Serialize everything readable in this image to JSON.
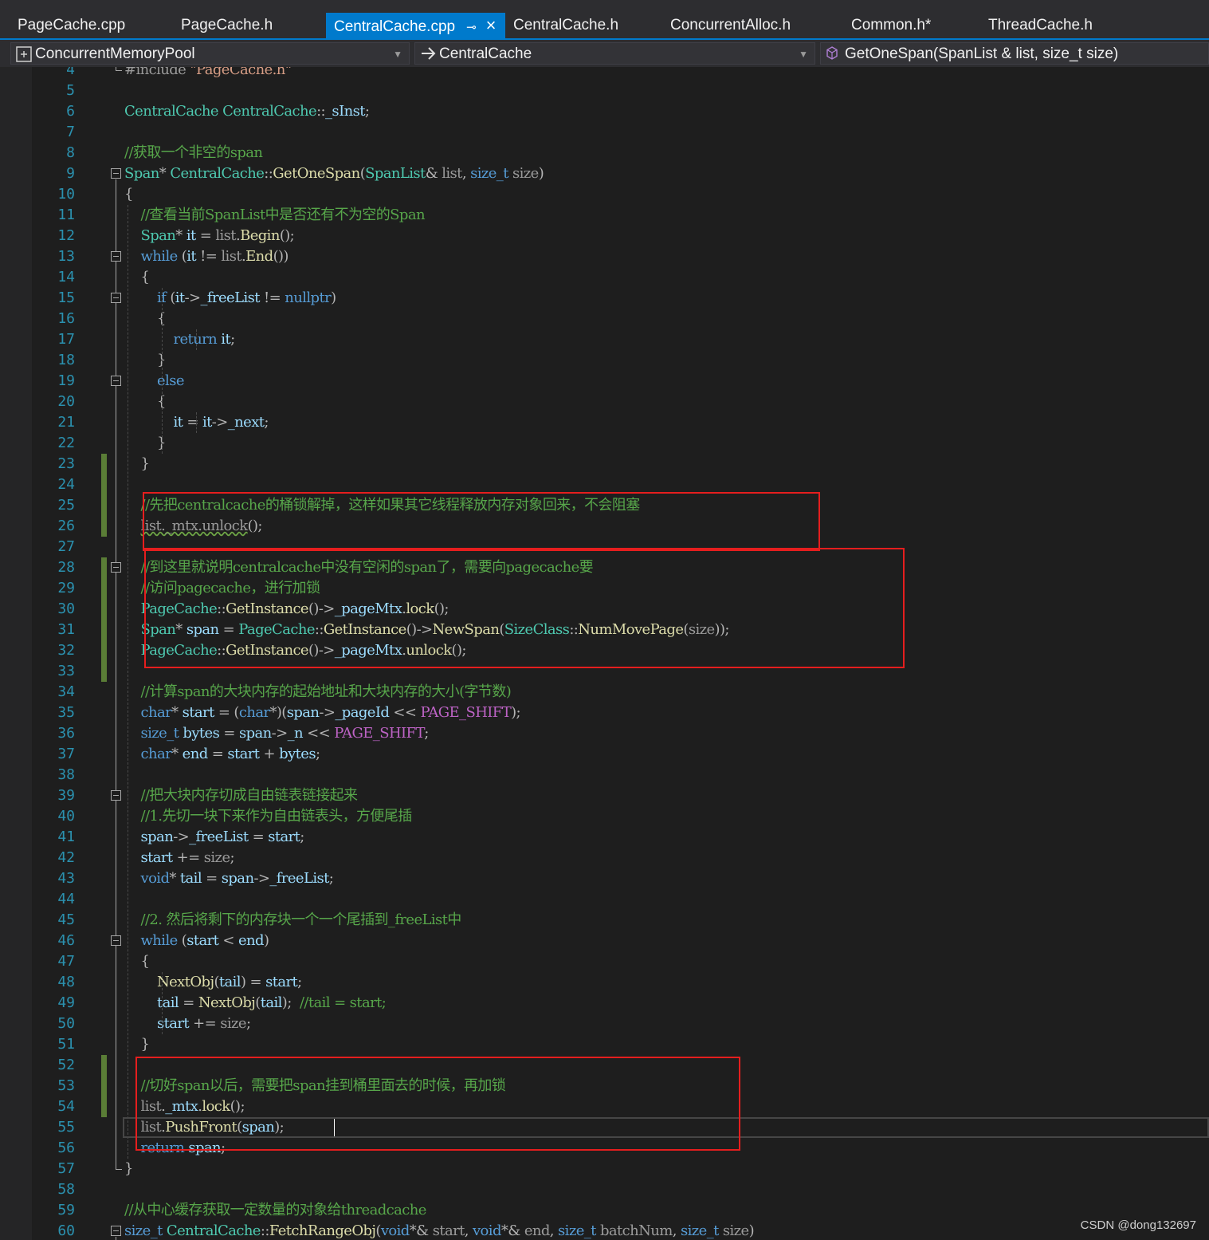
{
  "tabs": [
    {
      "label": "PageCache.cpp",
      "active": false
    },
    {
      "label": "PageCache.h",
      "active": false
    },
    {
      "label": "CentralCache.cpp",
      "active": true
    },
    {
      "label": "CentralCache.h",
      "active": false
    },
    {
      "label": "ConcurrentAlloc.h",
      "active": false
    },
    {
      "label": "Common.h*",
      "active": false
    },
    {
      "label": "ThreadCache.h",
      "active": false
    }
  ],
  "tab_icons": {
    "pin": "pin-icon",
    "close": "close-icon"
  },
  "navbar": {
    "project": "ConcurrentMemoryPool",
    "scope": "CentralCache",
    "member": "GetOneSpan(SpanList & list, size_t size)",
    "project_icon": "project-icon",
    "scope_icon": "arrow-right-icon",
    "member_icon": "method-cube-icon",
    "dropdown_icon": "chevron-down-icon"
  },
  "editor": {
    "first_line": 4,
    "caret_line": 55,
    "lines": [
      [
        [
          "pp",
          "#include "
        ],
        [
          "s",
          "\"PageCache.h\""
        ]
      ],
      [],
      [
        [
          "t",
          "CentralCache"
        ],
        [
          "x",
          " "
        ],
        [
          "t",
          "CentralCache"
        ],
        [
          "p",
          "::"
        ],
        [
          "v",
          "_sInst"
        ],
        [
          "p",
          ";"
        ]
      ],
      [],
      [
        [
          "c",
          "//获取一个非空的span"
        ]
      ],
      [
        [
          "t",
          "Span"
        ],
        [
          "p",
          "* "
        ],
        [
          "t",
          "CentralCache"
        ],
        [
          "p",
          "::"
        ],
        [
          "f",
          "GetOneSpan"
        ],
        [
          "p",
          "("
        ],
        [
          "t",
          "SpanList"
        ],
        [
          "p",
          "& "
        ],
        [
          "pp",
          "list"
        ],
        [
          "p",
          ", "
        ],
        [
          "k",
          "size_t"
        ],
        [
          "x",
          " "
        ],
        [
          "pp",
          "size"
        ],
        [
          "p",
          ")"
        ]
      ],
      [
        [
          "p",
          "{"
        ]
      ],
      [
        [
          "x",
          "    "
        ],
        [
          "c",
          "//查看当前SpanList中是否还有不为空的Span"
        ]
      ],
      [
        [
          "x",
          "    "
        ],
        [
          "t",
          "Span"
        ],
        [
          "p",
          "* "
        ],
        [
          "v",
          "it"
        ],
        [
          "p",
          " = "
        ],
        [
          "pp",
          "list"
        ],
        [
          "p",
          "."
        ],
        [
          "f",
          "Begin"
        ],
        [
          "p",
          "();"
        ]
      ],
      [
        [
          "x",
          "    "
        ],
        [
          "k",
          "while"
        ],
        [
          "p",
          " ("
        ],
        [
          "v",
          "it"
        ],
        [
          "p",
          " != "
        ],
        [
          "pp",
          "list"
        ],
        [
          "p",
          "."
        ],
        [
          "f",
          "End"
        ],
        [
          "p",
          "())"
        ]
      ],
      [
        [
          "x",
          "    "
        ],
        [
          "p",
          "{"
        ]
      ],
      [
        [
          "x",
          "        "
        ],
        [
          "k",
          "if"
        ],
        [
          "p",
          " ("
        ],
        [
          "v",
          "it"
        ],
        [
          "p",
          "->"
        ],
        [
          "v",
          "_freeList"
        ],
        [
          "p",
          " != "
        ],
        [
          "k",
          "nullptr"
        ],
        [
          "p",
          ")"
        ]
      ],
      [
        [
          "x",
          "        "
        ],
        [
          "p",
          "{"
        ]
      ],
      [
        [
          "x",
          "            "
        ],
        [
          "k",
          "return"
        ],
        [
          "x",
          " "
        ],
        [
          "v",
          "it"
        ],
        [
          "p",
          ";"
        ]
      ],
      [
        [
          "x",
          "        "
        ],
        [
          "p",
          "}"
        ]
      ],
      [
        [
          "x",
          "        "
        ],
        [
          "k",
          "else"
        ]
      ],
      [
        [
          "x",
          "        "
        ],
        [
          "p",
          "{"
        ]
      ],
      [
        [
          "x",
          "            "
        ],
        [
          "v",
          "it"
        ],
        [
          "p",
          " = "
        ],
        [
          "v",
          "it"
        ],
        [
          "p",
          "->"
        ],
        [
          "v",
          "_next"
        ],
        [
          "p",
          ";"
        ]
      ],
      [
        [
          "x",
          "        "
        ],
        [
          "p",
          "}"
        ]
      ],
      [
        [
          "x",
          "    "
        ],
        [
          "p",
          "}"
        ]
      ],
      [],
      [
        [
          "x",
          "    "
        ],
        [
          "c",
          "//先把centralcache的桶锁解掉，这样如果其它线程释放内存对象回来，不会阻塞"
        ]
      ],
      [
        [
          "x",
          "    "
        ],
        [
          "sq",
          "list._mtx.unlock"
        ],
        [
          "p",
          "();"
        ]
      ],
      [],
      [
        [
          "x",
          "    "
        ],
        [
          "c",
          "//到这里就说明centralcache中没有空闲的span了，需要向pagecache要"
        ]
      ],
      [
        [
          "x",
          "    "
        ],
        [
          "c",
          "//访问pagecache，进行加锁"
        ]
      ],
      [
        [
          "x",
          "    "
        ],
        [
          "t",
          "PageCache"
        ],
        [
          "p",
          "::"
        ],
        [
          "f",
          "GetInstance"
        ],
        [
          "p",
          "()->"
        ],
        [
          "v",
          "_pageMtx"
        ],
        [
          "p",
          "."
        ],
        [
          "f",
          "lock"
        ],
        [
          "p",
          "();"
        ]
      ],
      [
        [
          "x",
          "    "
        ],
        [
          "t",
          "Span"
        ],
        [
          "p",
          "* "
        ],
        [
          "v",
          "span"
        ],
        [
          "p",
          " = "
        ],
        [
          "t",
          "PageCache"
        ],
        [
          "p",
          "::"
        ],
        [
          "f",
          "GetInstance"
        ],
        [
          "p",
          "()->"
        ],
        [
          "f",
          "NewSpan"
        ],
        [
          "p",
          "("
        ],
        [
          "t",
          "SizeClass"
        ],
        [
          "p",
          "::"
        ],
        [
          "f",
          "NumMovePage"
        ],
        [
          "p",
          "("
        ],
        [
          "pp",
          "size"
        ],
        [
          "p",
          "));"
        ]
      ],
      [
        [
          "x",
          "    "
        ],
        [
          "t",
          "PageCache"
        ],
        [
          "p",
          "::"
        ],
        [
          "f",
          "GetInstance"
        ],
        [
          "p",
          "()->"
        ],
        [
          "v",
          "_pageMtx"
        ],
        [
          "p",
          "."
        ],
        [
          "f",
          "unlock"
        ],
        [
          "p",
          "();"
        ]
      ],
      [],
      [
        [
          "x",
          "    "
        ],
        [
          "c",
          "//计算span的大块内存的起始地址和大块内存的大小(字节数)"
        ]
      ],
      [
        [
          "x",
          "    "
        ],
        [
          "k",
          "char"
        ],
        [
          "p",
          "* "
        ],
        [
          "v",
          "start"
        ],
        [
          "p",
          " = ("
        ],
        [
          "k",
          "char"
        ],
        [
          "p",
          "*)("
        ],
        [
          "v",
          "span"
        ],
        [
          "p",
          "->"
        ],
        [
          "v",
          "_pageId"
        ],
        [
          "p",
          " << "
        ],
        [
          "mac",
          "PAGE_SHIFT"
        ],
        [
          "p",
          ");"
        ]
      ],
      [
        [
          "x",
          "    "
        ],
        [
          "k",
          "size_t"
        ],
        [
          "x",
          " "
        ],
        [
          "v",
          "bytes"
        ],
        [
          "p",
          " = "
        ],
        [
          "v",
          "span"
        ],
        [
          "p",
          "->"
        ],
        [
          "v",
          "_n"
        ],
        [
          "p",
          " << "
        ],
        [
          "mac",
          "PAGE_SHIFT"
        ],
        [
          "p",
          ";"
        ]
      ],
      [
        [
          "x",
          "    "
        ],
        [
          "k",
          "char"
        ],
        [
          "p",
          "* "
        ],
        [
          "v",
          "end"
        ],
        [
          "p",
          " = "
        ],
        [
          "v",
          "start"
        ],
        [
          "p",
          " + "
        ],
        [
          "v",
          "bytes"
        ],
        [
          "p",
          ";"
        ]
      ],
      [],
      [
        [
          "x",
          "    "
        ],
        [
          "c",
          "//把大块内存切成自由链表链接起来"
        ]
      ],
      [
        [
          "x",
          "    "
        ],
        [
          "c",
          "//1.先切一块下来作为自由链表头，方便尾插"
        ]
      ],
      [
        [
          "x",
          "    "
        ],
        [
          "v",
          "span"
        ],
        [
          "p",
          "->"
        ],
        [
          "v",
          "_freeList"
        ],
        [
          "p",
          " = "
        ],
        [
          "v",
          "start"
        ],
        [
          "p",
          ";"
        ]
      ],
      [
        [
          "x",
          "    "
        ],
        [
          "v",
          "start"
        ],
        [
          "p",
          " += "
        ],
        [
          "pp",
          "size"
        ],
        [
          "p",
          ";"
        ]
      ],
      [
        [
          "x",
          "    "
        ],
        [
          "k",
          "void"
        ],
        [
          "p",
          "* "
        ],
        [
          "v",
          "tail"
        ],
        [
          "p",
          " = "
        ],
        [
          "v",
          "span"
        ],
        [
          "p",
          "->"
        ],
        [
          "v",
          "_freeList"
        ],
        [
          "p",
          ";"
        ]
      ],
      [],
      [
        [
          "x",
          "    "
        ],
        [
          "c",
          "//2. 然后将剩下的内存块一个一个尾插到_freeList中"
        ]
      ],
      [
        [
          "x",
          "    "
        ],
        [
          "k",
          "while"
        ],
        [
          "p",
          " ("
        ],
        [
          "v",
          "start"
        ],
        [
          "p",
          " < "
        ],
        [
          "v",
          "end"
        ],
        [
          "p",
          ")"
        ]
      ],
      [
        [
          "x",
          "    "
        ],
        [
          "p",
          "{"
        ]
      ],
      [
        [
          "x",
          "        "
        ],
        [
          "f",
          "NextObj"
        ],
        [
          "p",
          "("
        ],
        [
          "v",
          "tail"
        ],
        [
          "p",
          ") = "
        ],
        [
          "v",
          "start"
        ],
        [
          "p",
          ";"
        ]
      ],
      [
        [
          "x",
          "        "
        ],
        [
          "v",
          "tail"
        ],
        [
          "p",
          " = "
        ],
        [
          "f",
          "NextObj"
        ],
        [
          "p",
          "("
        ],
        [
          "v",
          "tail"
        ],
        [
          "p",
          ");  "
        ],
        [
          "c",
          "//tail = start;"
        ]
      ],
      [
        [
          "x",
          "        "
        ],
        [
          "v",
          "start"
        ],
        [
          "p",
          " += "
        ],
        [
          "pp",
          "size"
        ],
        [
          "p",
          ";"
        ]
      ],
      [
        [
          "x",
          "    "
        ],
        [
          "p",
          "}"
        ]
      ],
      [],
      [
        [
          "x",
          "    "
        ],
        [
          "c",
          "//切好span以后，需要把span挂到桶里面去的时候，再加锁"
        ]
      ],
      [
        [
          "x",
          "    "
        ],
        [
          "pp",
          "list"
        ],
        [
          "p",
          "."
        ],
        [
          "v",
          "_mtx"
        ],
        [
          "p",
          "."
        ],
        [
          "f",
          "lock"
        ],
        [
          "p",
          "();"
        ]
      ],
      [
        [
          "x",
          "    "
        ],
        [
          "pp",
          "list"
        ],
        [
          "p",
          "."
        ],
        [
          "f",
          "PushFront"
        ],
        [
          "p",
          "("
        ],
        [
          "v",
          "span"
        ],
        [
          "p",
          ");"
        ]
      ],
      [
        [
          "x",
          "    "
        ],
        [
          "k",
          "return"
        ],
        [
          "x",
          " "
        ],
        [
          "v",
          "span"
        ],
        [
          "p",
          ";"
        ]
      ],
      [
        [
          "p",
          "}"
        ]
      ],
      [],
      [
        [
          "c",
          "//从中心缓存获取一定数量的对象给threadcache"
        ]
      ],
      [
        [
          "k",
          "size_t"
        ],
        [
          "x",
          " "
        ],
        [
          "t",
          "CentralCache"
        ],
        [
          "p",
          "::"
        ],
        [
          "f",
          "FetchRangeObj"
        ],
        [
          "p",
          "("
        ],
        [
          "k",
          "void"
        ],
        [
          "p",
          "*& "
        ],
        [
          "pp",
          "start"
        ],
        [
          "p",
          ", "
        ],
        [
          "k",
          "void"
        ],
        [
          "p",
          "*& "
        ],
        [
          "pp",
          "end"
        ],
        [
          "p",
          ", "
        ],
        [
          "k",
          "size_t"
        ],
        [
          "x",
          " "
        ],
        [
          "pp",
          "batchNum"
        ],
        [
          "p",
          ", "
        ],
        [
          "k",
          "size_t"
        ],
        [
          "x",
          " "
        ],
        [
          "pp",
          "size"
        ],
        [
          "p",
          ")"
        ]
      ]
    ]
  },
  "watermark": "CSDN @dong132697",
  "colors": {
    "background": "#1e1e1e",
    "accent": "#007acc",
    "highlight_box": "#e51e1e",
    "line_number": "#2b91af",
    "comment": "#57a64a",
    "keyword": "#569cd6",
    "type": "#4ec9b0",
    "function": "#dcdcaa",
    "variable": "#9cdcfe",
    "change_bar": "#5a7d36"
  }
}
